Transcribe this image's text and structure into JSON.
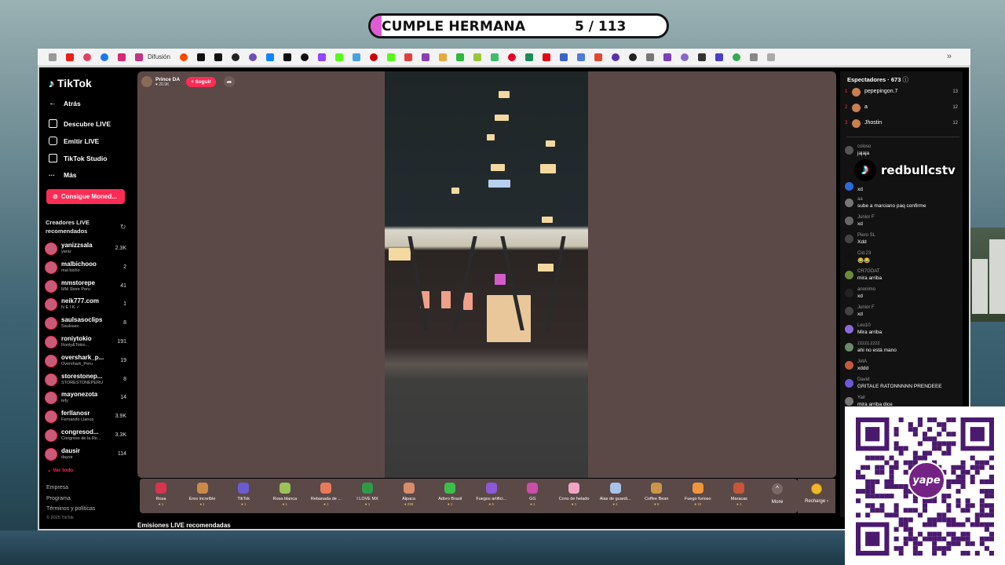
{
  "banner": {
    "title": "CUMPLE HERMANA",
    "counter": "5 / 113"
  },
  "bookmarks": {
    "first_label": "Difusión",
    "more": "»"
  },
  "tiktok": {
    "logo": "TikTok",
    "nav": {
      "back": "Atrás",
      "discover": "Descubre LIVE",
      "go_live": "Emitir LIVE",
      "studio": "TikTok Studio",
      "more": "Más"
    },
    "coins_button": "Consigue Moned...",
    "recommended_title_1": "Creadores LIVE",
    "recommended_title_2": "recomendados",
    "creators": [
      {
        "name": "yanizzsala",
        "sub": "yaniz",
        "count": "2.3K"
      },
      {
        "name": "malbichooo",
        "sub": "mal bicho",
        "count": "2"
      },
      {
        "name": "mmstorepe",
        "sub": "MM Store Peru",
        "count": "41"
      },
      {
        "name": "neik777.com",
        "sub": "N E I K ✓",
        "count": "1"
      },
      {
        "name": "saulsasoclips",
        "sub": "Saulsaso",
        "count": "8"
      },
      {
        "name": "roniytokio",
        "sub": "Roniy&Tokio...",
        "count": "191"
      },
      {
        "name": "overshark_p...",
        "sub": "Overshark_Peru",
        "count": "19"
      },
      {
        "name": "storestonep...",
        "sub": "STORESTONEPERU",
        "count": "8"
      },
      {
        "name": "mayonezota",
        "sub": "tefy",
        "count": "14"
      },
      {
        "name": "ferllanosr",
        "sub": "Fernando Llanos",
        "count": "3.9K"
      },
      {
        "name": "congresod...",
        "sub": "Congreso de la Re...",
        "count": "3.3K"
      },
      {
        "name": "dausir",
        "sub": "daysir",
        "count": "114"
      }
    ],
    "see_all": "Ver todo",
    "footer": {
      "company": "Empresa",
      "program": "Programa",
      "terms": "Términos y políticas",
      "copyright": "© 2025 TikTok"
    }
  },
  "stream": {
    "host_name": "Prince DA",
    "host_likes": "20.9K",
    "follow_label": "+ Seguir",
    "gifts": [
      {
        "name": "Rosa",
        "price": "1"
      },
      {
        "name": "Eres increíble",
        "price": "1"
      },
      {
        "name": "TikTok",
        "price": "1"
      },
      {
        "name": "Rosa blanca",
        "price": "1"
      },
      {
        "name": "Rebanada de ...",
        "price": "1"
      },
      {
        "name": "I LOVE MX",
        "price": "1"
      },
      {
        "name": "Alpaca",
        "price": "299"
      },
      {
        "name": "Adoro Brasil",
        "price": "1"
      },
      {
        "name": "Fuegos artifici...",
        "price": "5"
      },
      {
        "name": "GG",
        "price": "1"
      },
      {
        "name": "Cono de helado",
        "price": "1"
      },
      {
        "name": "Alas de guardi...",
        "price": "1"
      },
      {
        "name": "Coffee Bean",
        "price": "5"
      },
      {
        "name": "Fuego furioso",
        "price": "10"
      },
      {
        "name": "Maracas",
        "price": "1"
      }
    ],
    "more_label": "More",
    "recharge_label": "Recharge",
    "recommended_streams": "Emisiones LIVE recomendadas"
  },
  "chat": {
    "viewers_label": "Espectadores · 673",
    "top_viewers": [
      {
        "rank": "1",
        "name": "pepepingon.7",
        "score": "13"
      },
      {
        "rank": "2",
        "name": "a",
        "score": "12"
      },
      {
        "rank": "3",
        "name": "Jhostin",
        "score": "12"
      }
    ],
    "messages": [
      {
        "user": "coloso",
        "text": "jajaja"
      },
      {
        "user": "",
        "text": "xd"
      },
      {
        "user": "aa",
        "text": "sube a marciano paq confirme"
      },
      {
        "user": "Junior F",
        "text": "xd"
      },
      {
        "user": "Piero SL",
        "text": "Xdd"
      },
      {
        "user": "Cid.23",
        "text": "😂😂"
      },
      {
        "user": "CR7GOAT",
        "text": "mira arriba"
      },
      {
        "user": "anonimo",
        "text": "xd"
      },
      {
        "user": "Junior F",
        "text": "xd"
      },
      {
        "user": "Leo10",
        "text": "Mira arriba"
      },
      {
        "user": "zzzzz.zzzz",
        "text": "ahi no está mano"
      },
      {
        "user": "JotA",
        "text": "xddd"
      },
      {
        "user": "David",
        "text": "GRITALE RATONNNNN PRENDEEE"
      },
      {
        "user": "Yair",
        "text": "mira arriba dice"
      }
    ]
  },
  "overlay": {
    "tiktok_handle": "redbullcstv",
    "yape_label": "S/ yape"
  },
  "colors": {
    "tiktok_red": "#fe2c55",
    "stage_bg": "#5b4948",
    "yape_purple": "#742284"
  }
}
